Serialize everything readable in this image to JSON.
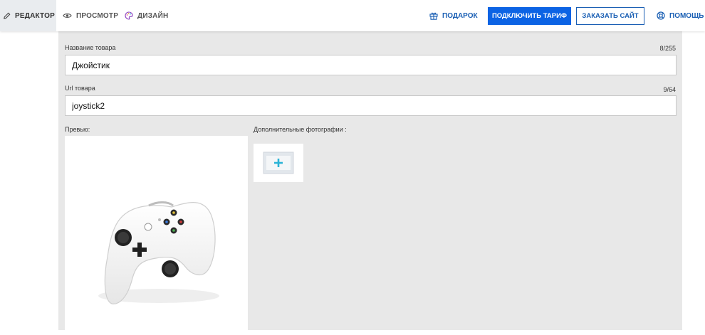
{
  "topbar": {
    "tabs": {
      "editor": "РЕДАКТОР",
      "preview": "ПРОСМОТР",
      "design": "ДИЗАЙН"
    },
    "gift_label": "ПОДАРОК",
    "tariff_button": "ПОДКЛЮЧИТЬ ТАРИФ",
    "order_button": "ЗАКАЗАТЬ САЙТ",
    "help_label": "ПОМОЩЬ"
  },
  "form": {
    "name": {
      "label": "Название товара",
      "counter": "8/255",
      "value": "Джойстик"
    },
    "url": {
      "label": "Url товара",
      "counter": "9/64",
      "value": "joystick2"
    },
    "preview_label": "Превью:",
    "extra_photos_label": "Дополнительные фотографии :"
  },
  "colors": {
    "accent": "#0c63e4",
    "link": "#1a5fb4",
    "panel": "#e8e8e8",
    "add_icon": "#2bb3d6"
  }
}
